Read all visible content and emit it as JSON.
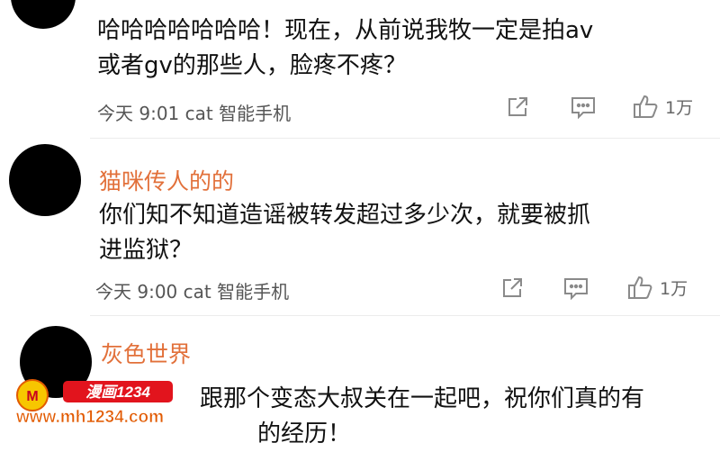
{
  "comments": [
    {
      "username": "",
      "text_lines": [
        "哈哈哈哈哈哈哈！现在，从前说我牧一定是拍av",
        "或者gv的那些人，脸疼不疼？"
      ],
      "time": "今天 9:01",
      "client": "cat 智能手机",
      "likes": "1万"
    },
    {
      "username": "猫咪传人的的",
      "text_lines": [
        "你们知不知道造谣被转发超过多少次，就要被抓",
        "进监狱？"
      ],
      "time": "今天 9:00",
      "client": "cat 智能手机",
      "likes": "1万"
    },
    {
      "username": "灰色世界",
      "text_lines": [
        "跟那个变态大叔关在一起吧，祝你们真的有",
        "的经历！"
      ],
      "time": "",
      "client": "",
      "likes": ""
    }
  ],
  "watermark": {
    "brand": "漫画1234",
    "url": "www.mh1234.com"
  },
  "icons": [
    "share-icon",
    "comment-icon",
    "like-icon"
  ],
  "colors": {
    "username": "#e2703a",
    "text": "#111111",
    "meta": "#555555",
    "icon": "#8a8a8a"
  }
}
